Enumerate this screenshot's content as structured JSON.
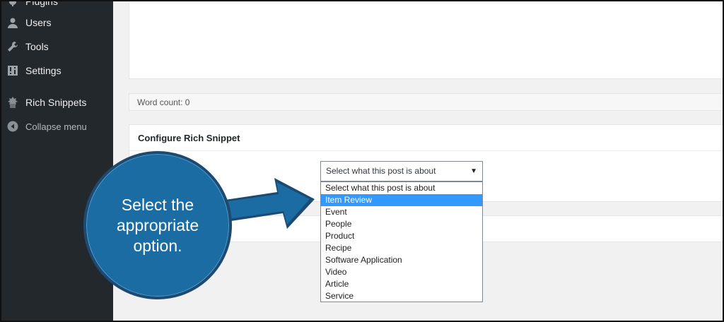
{
  "sidebar": {
    "items": [
      {
        "label": "Plugins",
        "icon": "plugin-icon"
      },
      {
        "label": "Users",
        "icon": "users-icon"
      },
      {
        "label": "Tools",
        "icon": "tools-icon"
      },
      {
        "label": "Settings",
        "icon": "settings-icon"
      },
      {
        "label": "Rich Snippets",
        "icon": "rich-snippets-icon"
      },
      {
        "label": "Collapse menu",
        "icon": "collapse-icon"
      }
    ]
  },
  "editor": {
    "word_count": "Word count: 0"
  },
  "metabox": {
    "title": "Configure Rich Snippet",
    "select": {
      "selected": "Select what this post is about",
      "highlighted": "Item Review",
      "options": [
        "Select what this post is about",
        "Item Review",
        "Event",
        "People",
        "Product",
        "Recipe",
        "Software Application",
        "Video",
        "Article",
        "Service"
      ]
    }
  },
  "callout": {
    "text": "Select the appropriate option."
  },
  "colors": {
    "sidebar_bg": "#23282d",
    "callout_bg": "#1a6ca3",
    "highlight": "#3399ff"
  }
}
